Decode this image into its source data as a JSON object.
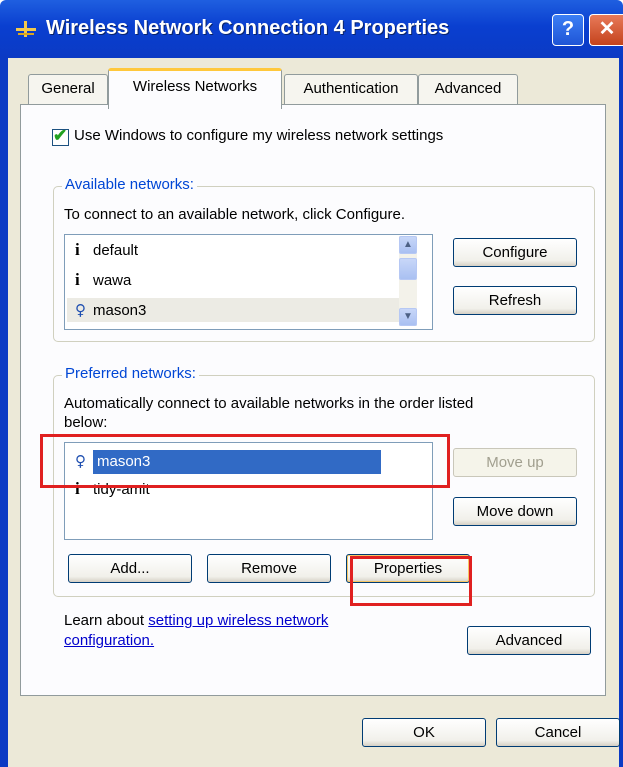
{
  "window": {
    "title": "Wireless Network Connection 4 Properties",
    "help_glyph": "?",
    "close_glyph": "✕"
  },
  "tabs": [
    {
      "label": "General"
    },
    {
      "label": "Wireless Networks"
    },
    {
      "label": "Authentication"
    },
    {
      "label": "Advanced"
    }
  ],
  "use_windows_checkbox": {
    "label": "Use Windows to configure my wireless network settings",
    "checked": true
  },
  "available": {
    "group_title": "Available networks:",
    "instruction": "To connect to an available network, click Configure.",
    "networks": [
      {
        "name": "default",
        "icon": "infrastructure-icon"
      },
      {
        "name": "wawa",
        "icon": "infrastructure-icon"
      },
      {
        "name": "mason3",
        "icon": "wireless-antenna-icon"
      }
    ],
    "configure_label": "Configure",
    "refresh_label": "Refresh"
  },
  "preferred": {
    "group_title": "Preferred networks:",
    "instruction_line1": "Automatically connect to available networks in the order listed",
    "instruction_line2": "below:",
    "networks": [
      {
        "name": "mason3",
        "icon": "wireless-antenna-icon",
        "selected": true
      },
      {
        "name": "tidy-amit",
        "icon": "infrastructure-icon"
      }
    ],
    "move_up_label": "Move up",
    "move_down_label": "Move down",
    "add_label": "Add...",
    "remove_label": "Remove",
    "properties_label": "Properties"
  },
  "learn": {
    "prefix": "Learn about ",
    "link_line1": "setting up wireless network",
    "link_line2": "configuration.",
    "advanced_label": "Advanced"
  },
  "footer": {
    "ok_label": "OK",
    "cancel_label": "Cancel"
  },
  "colors": {
    "titlebar": "#0b3ac4",
    "highlight_box": "#e02020",
    "selection": "#316ac5",
    "group_title": "#0046d5"
  }
}
